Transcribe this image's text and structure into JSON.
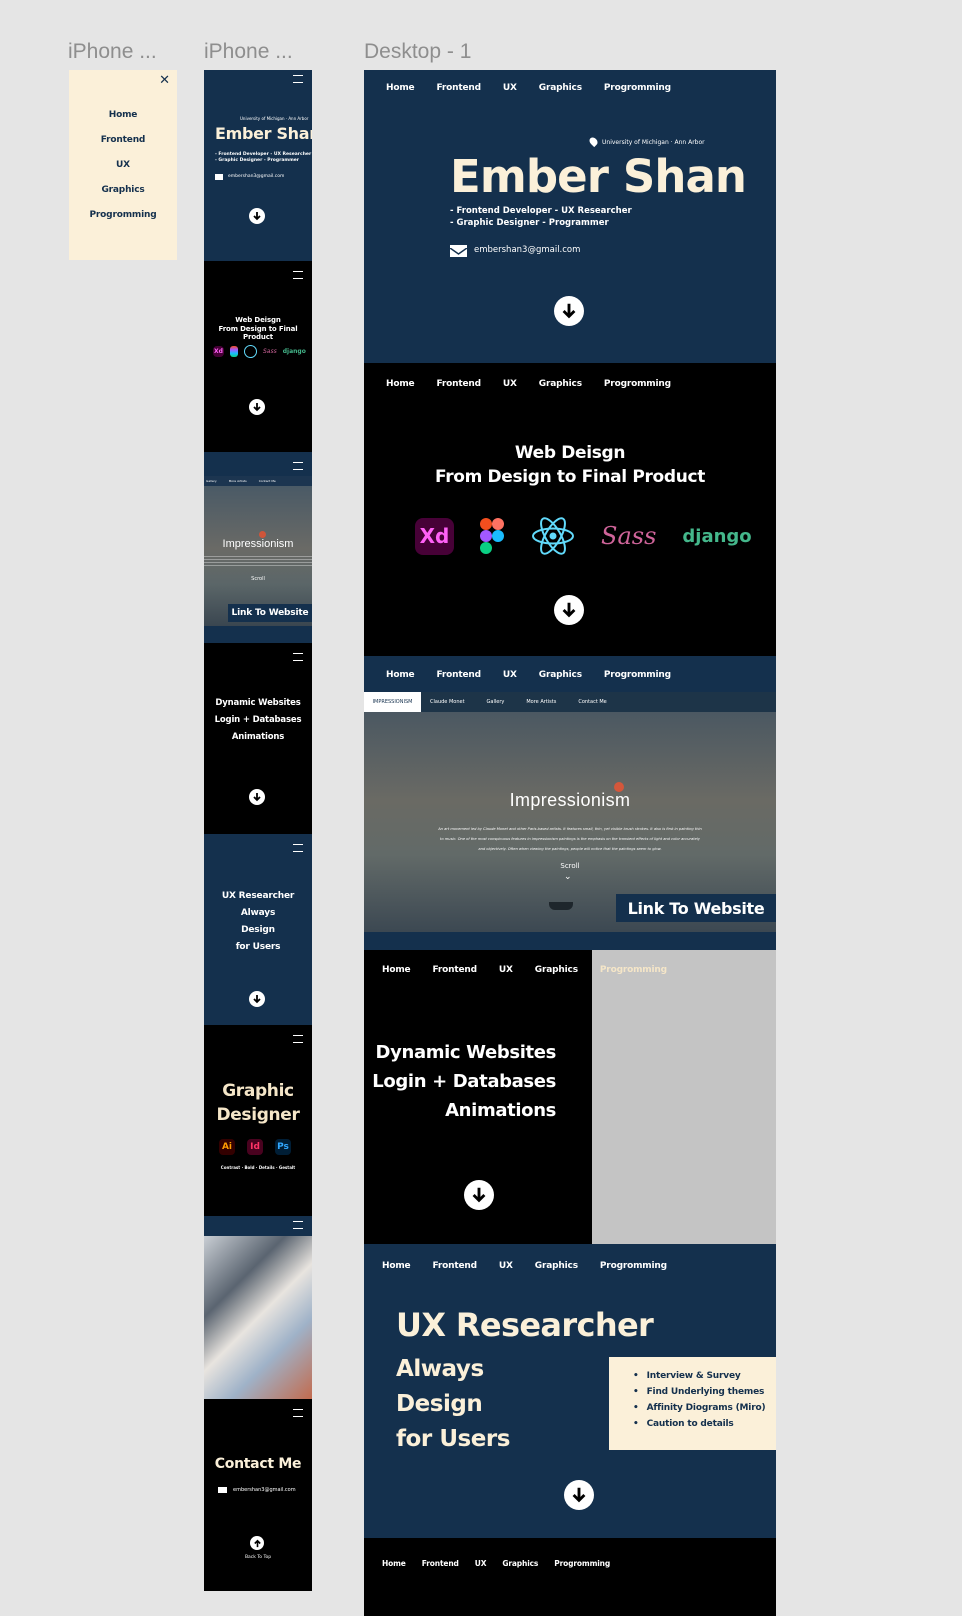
{
  "frames": {
    "menu": "iPhone ...",
    "mobile": "iPhone ...",
    "desktop": "Desktop - 1"
  },
  "nav": [
    "Home",
    "Frontend",
    "UX",
    "Graphics",
    "Progromming"
  ],
  "hero": {
    "location": "University of Michigan · Ann Arbor",
    "name": "Ember Shan",
    "roles": [
      "- Frontend Developer - UX Researcher",
      "- Graphic Designer - Programmer"
    ],
    "email": "embershan3@gmail.com"
  },
  "web": {
    "line1": "Web Deisgn",
    "line2": "From Design to Final Product",
    "logos": [
      "Xd",
      "Figma",
      "React",
      "Sass",
      "django"
    ]
  },
  "impressionism": {
    "tabs": [
      "IMPRESSIONISM",
      "Claude Monet",
      "Gallery",
      "More Artists",
      "Contact Me"
    ],
    "mobile_tabs": [
      "Gallery",
      "More Artists",
      "Contact Me"
    ],
    "title": "Impressionism",
    "desc1": "An art movement led by Claude Monet and other Paris-based artists. It features small, thin, yet visible brush strokes. It also is first in painting thin",
    "desc2": "to music. One of the most conspicuous features in impressionism paintings is the emphasis on the transient effects of light and color accurately",
    "desc3": "and objectively. Often when viewing the paintings, people will notice that the paintings seem to glow.",
    "scroll": "Scroll",
    "link": "Link To Website"
  },
  "dynamic": [
    "Dynamic Websites",
    "Login + Databases",
    "Animations"
  ],
  "ux": {
    "title": "UX Researcher",
    "lines": [
      "Always",
      "Design",
      "for Users"
    ],
    "bullets": [
      "Interview & Survey",
      "Find Underlying themes",
      "Affinity Diograms (Miro)",
      "Caution to details"
    ]
  },
  "graphic": {
    "line1": "Graphic",
    "line2": "Designer",
    "apps": [
      "Ai",
      "Id",
      "Ps"
    ],
    "tags": "Contrast · Bold · Details · Gestalt"
  },
  "contact": {
    "title": "Contact Me",
    "email": "embershan3@gmail.com",
    "back": "Back To Top"
  },
  "colors": {
    "navy": "#14304d",
    "black": "#000000",
    "cream": "#fbf0d9",
    "accent": "#f5e6c8"
  }
}
